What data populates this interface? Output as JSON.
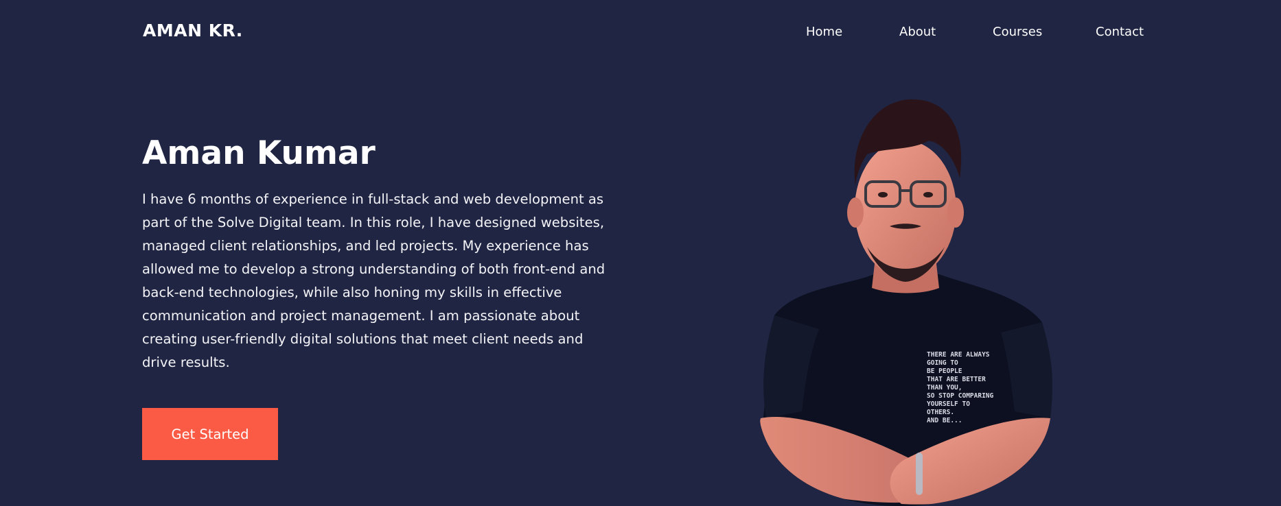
{
  "nav": {
    "logo": "AMAN KR.",
    "links": [
      "Home",
      "About",
      "Courses",
      "Contact"
    ]
  },
  "hero": {
    "title": "Aman Kumar",
    "description": "I have 6 months of experience in full-stack and web development as part of the Solve Digital team. In this role, I have designed websites, managed client relationships, and led projects. My experience has allowed me to develop a strong understanding of both front-end and back-end technologies, while also honing my skills in effective communication and project management. I am passionate about creating user-friendly digital solutions that meet client needs and drive results.",
    "cta": "Get Started"
  },
  "portrait": {
    "shirt_text": [
      "THERE ARE ALWAYS",
      "GOING TO",
      "BE PEOPLE",
      "THAT ARE BETTER",
      "THAN YOU,",
      "SO STOP COMPARING",
      "YOURSELF TO",
      "OTHERS.",
      "AND BE..."
    ]
  },
  "colors": {
    "background": "#1f2542",
    "accent": "#fb5b45",
    "text": "#ffffff"
  }
}
